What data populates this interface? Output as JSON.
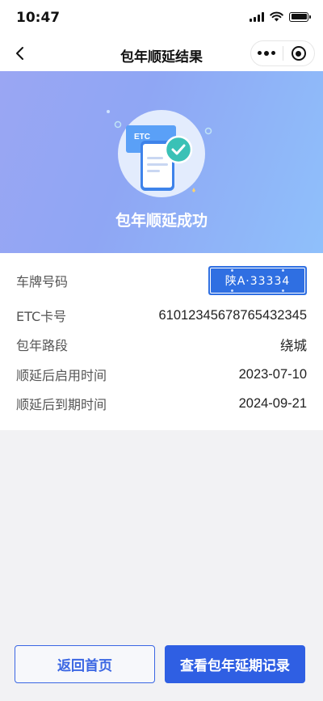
{
  "status_bar": {
    "time": "10:47"
  },
  "nav": {
    "title": "包年顺延结果"
  },
  "banner": {
    "title": "包年顺延成功",
    "card_label": "ETC",
    "bg_color": "#93aef6"
  },
  "info": {
    "rows": [
      {
        "label": "车牌号码",
        "plate": "陕A·33334"
      },
      {
        "label": "ETC卡号",
        "value": "61012345678765432345"
      },
      {
        "label": "包年路段",
        "value": "绕城"
      },
      {
        "label": "顺延后启用时间",
        "value": "2023-07-10"
      },
      {
        "label": "顺延后到期时间",
        "value": "2024-09-21"
      }
    ]
  },
  "actions": {
    "home_label": "返回首页",
    "records_label": "查看包年延期记录",
    "accent_color": "#2f5fe3"
  }
}
